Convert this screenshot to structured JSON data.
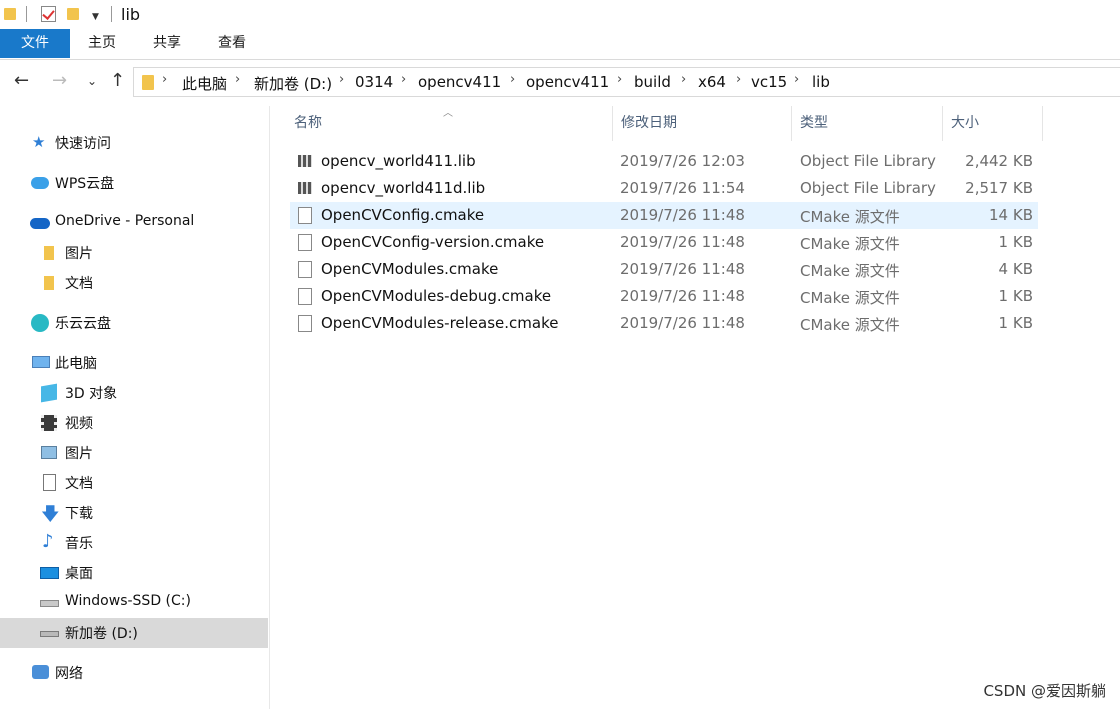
{
  "window": {
    "title": "lib"
  },
  "ribbon": {
    "tabs": [
      "文件",
      "主页",
      "共享",
      "查看"
    ]
  },
  "address": {
    "crumbs": [
      "此电脑",
      "新加卷 (D:)",
      "0314",
      "opencv411",
      "opencv411",
      "build",
      "x64",
      "vc15",
      "lib"
    ]
  },
  "sidebar": {
    "items": [
      {
        "label": "快速访问",
        "icon": "star-icon"
      },
      {
        "label": "WPS云盘",
        "icon": "cloud-icon"
      },
      {
        "label": "OneDrive - Personal",
        "icon": "onedrive-icon"
      },
      {
        "label": "图片",
        "icon": "folder-icon"
      },
      {
        "label": "文档",
        "icon": "folder-icon"
      },
      {
        "label": "乐云云盘",
        "icon": "cloud-icon"
      },
      {
        "label": "此电脑",
        "icon": "computer-icon"
      },
      {
        "label": "3D 对象",
        "icon": "cube-icon"
      },
      {
        "label": "视频",
        "icon": "film-icon"
      },
      {
        "label": "图片",
        "icon": "picture-icon"
      },
      {
        "label": "文档",
        "icon": "document-icon"
      },
      {
        "label": "下载",
        "icon": "download-icon"
      },
      {
        "label": "音乐",
        "icon": "music-icon"
      },
      {
        "label": "桌面",
        "icon": "desktop-icon"
      },
      {
        "label": "Windows-SSD (C:)",
        "icon": "drive-icon"
      },
      {
        "label": "新加卷 (D:)",
        "icon": "drive-icon"
      },
      {
        "label": "网络",
        "icon": "network-icon"
      }
    ]
  },
  "columns": {
    "name": "名称",
    "date": "修改日期",
    "type": "类型",
    "size": "大小"
  },
  "files": [
    {
      "name": "opencv_world411.lib",
      "date": "2019/7/26 12:03",
      "type": "Object File Library",
      "size": "2,442 KB"
    },
    {
      "name": "opencv_world411d.lib",
      "date": "2019/7/26 11:54",
      "type": "Object File Library",
      "size": "2,517 KB"
    },
    {
      "name": "OpenCVConfig.cmake",
      "date": "2019/7/26 11:48",
      "type": "CMake 源文件",
      "size": "14 KB"
    },
    {
      "name": "OpenCVConfig-version.cmake",
      "date": "2019/7/26 11:48",
      "type": "CMake 源文件",
      "size": "1 KB"
    },
    {
      "name": "OpenCVModules.cmake",
      "date": "2019/7/26 11:48",
      "type": "CMake 源文件",
      "size": "4 KB"
    },
    {
      "name": "OpenCVModules-debug.cmake",
      "date": "2019/7/26 11:48",
      "type": "CMake 源文件",
      "size": "1 KB"
    },
    {
      "name": "OpenCVModules-release.cmake",
      "date": "2019/7/26 11:48",
      "type": "CMake 源文件",
      "size": "1 KB"
    }
  ],
  "watermark": "CSDN @爱因斯躺",
  "colors": {
    "accent": "#1979ca",
    "hover": "#e5f3ff",
    "selected": "#d9d9d9"
  }
}
